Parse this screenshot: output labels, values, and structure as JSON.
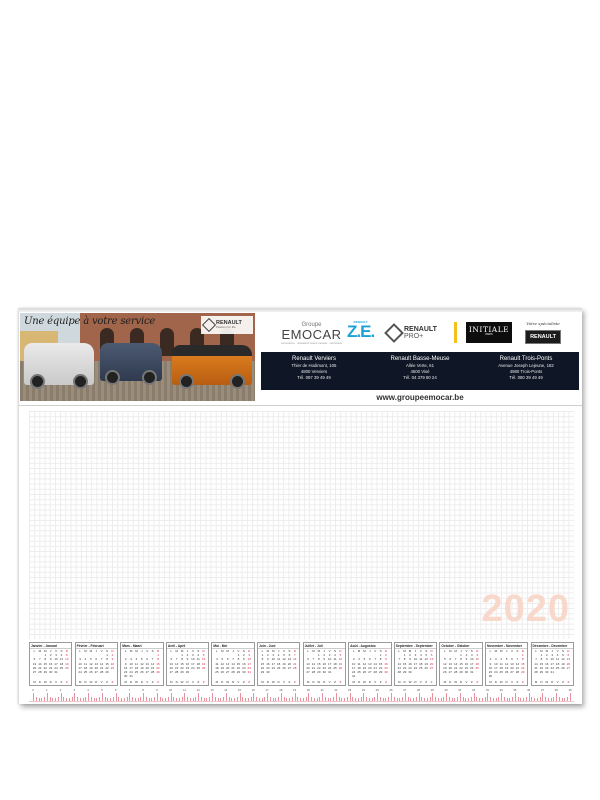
{
  "product": "desk-pad-calendar",
  "header": {
    "photo": {
      "slogan": "Une équipe à votre service",
      "badge_brand": "RENAULT",
      "badge_tagline": "Passion for life"
    },
    "logos": {
      "emocar_group": "Groupe",
      "emocar_name": "EMOCAR",
      "emocar_tagline": "concessions · réparations toutes marques · carrosserie",
      "ze_small": "RENAULT",
      "ze_big": "Z.E.",
      "pro_brand": "RENAULT",
      "pro_suffix": "PRO+",
      "initiale": "INITIALE",
      "initiale_sub": "PARIS",
      "specialist_label": "Votre spécialiste",
      "specialist_badge": "RENAULT"
    },
    "dealers": [
      {
        "name": "Renault Verviers",
        "lines": [
          "Thier de Hodimont, 105",
          "4800 Verviers",
          "Tél. 087 39 49 49"
        ]
      },
      {
        "name": "Renault Basse-Meuse",
        "lines": [
          "Allée Verte, 61",
          "4600 Visé",
          "Tél. 04 379 80 24"
        ]
      },
      {
        "name": "Renault Trois-Ponts",
        "lines": [
          "Avenue Joseph Lejeune, 182",
          "4980 Trois-Ponts",
          "Tél. 080 39 49 49"
        ]
      }
    ],
    "website": "www.groupeemocar.be",
    "colors": {
      "dealer_bar": "#0f1726",
      "ze_blue": "#1aa2d8",
      "accent_yellow": "#f2c21b"
    }
  },
  "year": "2020",
  "year_color": "#f7d8ca",
  "weekday_header": [
    "L",
    "M",
    "M",
    "J",
    "V",
    "S",
    "D"
  ],
  "weekday_footer": [
    "M",
    "D",
    "W",
    "D",
    "V",
    "Z",
    "Z"
  ],
  "months": [
    {
      "name": "Janvier - Januari",
      "offset": 2,
      "days": 31
    },
    {
      "name": "Février - Februari",
      "offset": 5,
      "days": 29
    },
    {
      "name": "Mars - Maart",
      "offset": 6,
      "days": 31
    },
    {
      "name": "Avril - April",
      "offset": 2,
      "days": 30
    },
    {
      "name": "Mai - Mei",
      "offset": 4,
      "days": 31
    },
    {
      "name": "Juin - Juni",
      "offset": 0,
      "days": 30
    },
    {
      "name": "Juillet - Juli",
      "offset": 2,
      "days": 31
    },
    {
      "name": "Août - Augustus",
      "offset": 5,
      "days": 31
    },
    {
      "name": "Septembre - September",
      "offset": 1,
      "days": 30
    },
    {
      "name": "Octobre - Oktober",
      "offset": 3,
      "days": 31
    },
    {
      "name": "Novembre - November",
      "offset": 6,
      "days": 30
    },
    {
      "name": "Décembre - December",
      "offset": 1,
      "days": 31
    }
  ],
  "ruler": {
    "start": 0,
    "end": 39,
    "unit": "cm"
  }
}
